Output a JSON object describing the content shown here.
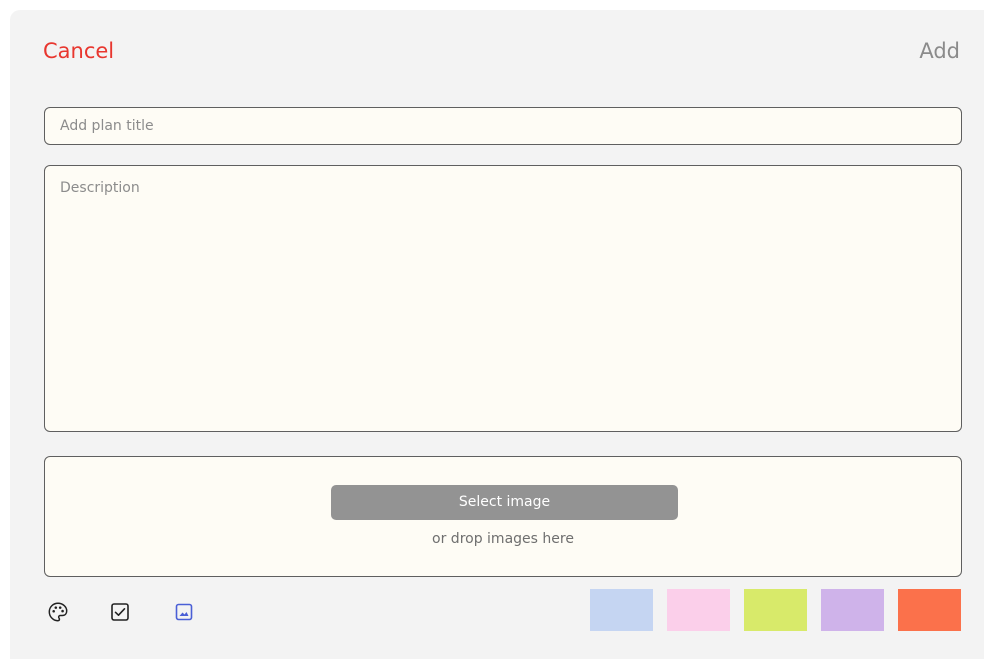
{
  "header": {
    "cancel_label": "Cancel",
    "add_label": "Add"
  },
  "form": {
    "title_placeholder": "Add plan title",
    "title_value": "",
    "description_placeholder": "Description",
    "description_value": ""
  },
  "image_upload": {
    "select_label": "Select image",
    "drop_label": "or drop images here"
  },
  "toolbar": {
    "icons": [
      "palette-icon",
      "checkbox-icon",
      "image-icon"
    ],
    "active_icon": "image-icon",
    "active_color": "#4a5fd6"
  },
  "colors": {
    "swatches": [
      "#c5d5f2",
      "#fbcfea",
      "#d8ea6a",
      "#cfb3ea",
      "#fb714b"
    ],
    "cancel": "#e8362e",
    "add": "#8b8b8b"
  }
}
